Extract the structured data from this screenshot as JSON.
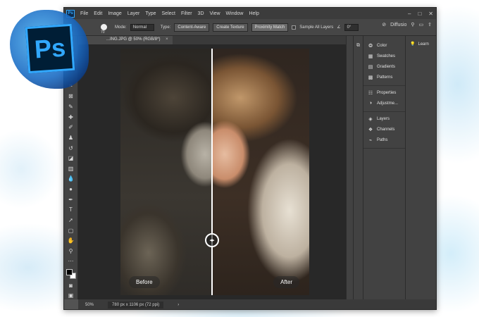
{
  "app": {
    "name": "Ps",
    "menus": [
      "File",
      "Edit",
      "Image",
      "Layer",
      "Type",
      "Select",
      "Filter",
      "3D",
      "View",
      "Window",
      "Help"
    ],
    "window_controls": [
      "–",
      "□",
      "✕"
    ]
  },
  "options_bar": {
    "brush_size": "70",
    "mode_label": "Mode:",
    "mode_value": "Normal",
    "type_label": "Type:",
    "type_options": [
      "Content-Aware",
      "Create Texture",
      "Proximity Match"
    ],
    "sample_all_layers": "Sample All Layers",
    "angle_value": "0°",
    "workspace": "Diffusio"
  },
  "document_tab": {
    "title": "...ING.JPG @ 50% (RGB/8*)",
    "close": "×"
  },
  "canvas": {
    "before_label": "Before",
    "after_label": "After",
    "handle_glyph": "◂▸"
  },
  "panels": {
    "group1": [
      {
        "icon": "color-wheel-icon",
        "label": "Color"
      },
      {
        "icon": "grid-icon",
        "label": "Swatches"
      },
      {
        "icon": "gradient-icon",
        "label": "Gradients"
      },
      {
        "icon": "pattern-icon",
        "label": "Patterns"
      }
    ],
    "group2": [
      {
        "icon": "sliders-icon",
        "label": "Properties"
      },
      {
        "icon": "half-circle-icon",
        "label": "Adjustme..."
      }
    ],
    "group3": [
      {
        "icon": "layers-icon",
        "label": "Layers"
      },
      {
        "icon": "channels-icon",
        "label": "Channels"
      },
      {
        "icon": "pen-path-icon",
        "label": "Paths"
      }
    ],
    "learn": "Learn"
  },
  "status": {
    "zoom": "50%",
    "doc_size": "780 px x 1106 px (72 ppi)"
  }
}
